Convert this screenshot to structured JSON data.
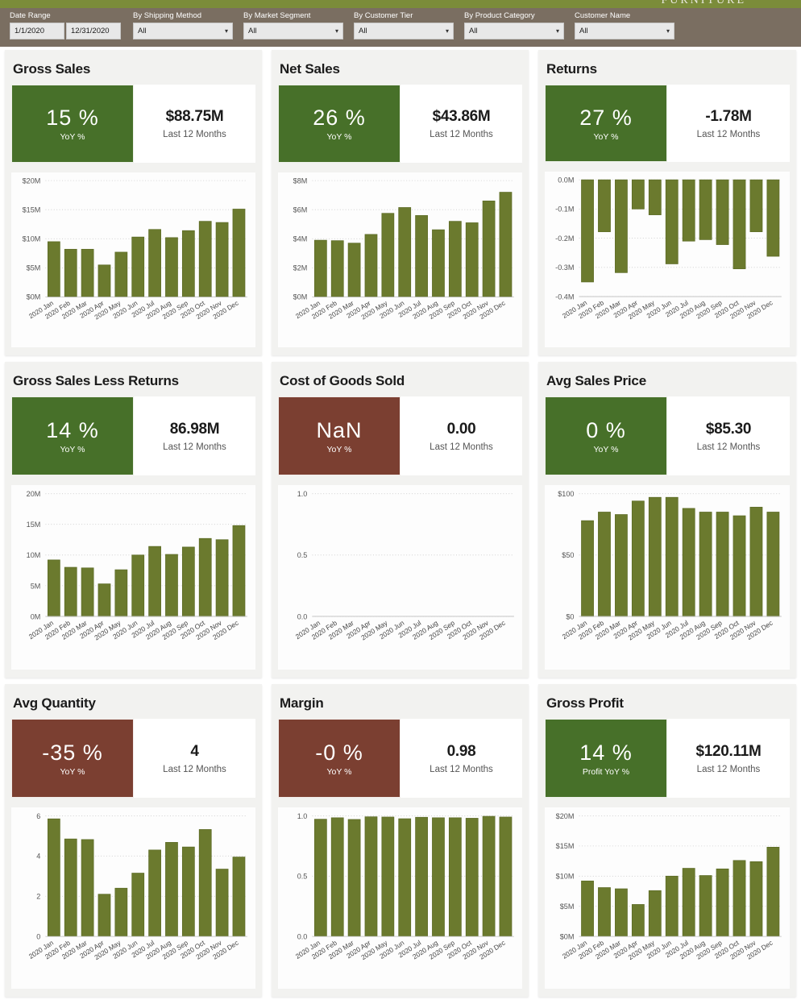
{
  "header": {
    "logo_text": "FURNITURE",
    "filters": [
      {
        "label": "Date Range",
        "type": "daterange",
        "start": "1/1/2020",
        "end": "12/31/2020"
      },
      {
        "label": "By Shipping Method",
        "type": "select",
        "value": "All"
      },
      {
        "label": "By Market Segment",
        "type": "select",
        "value": "All"
      },
      {
        "label": "By Customer Tier",
        "type": "select",
        "value": "All"
      },
      {
        "label": "By Product Category",
        "type": "select",
        "value": "All"
      },
      {
        "label": "Customer Name",
        "type": "select",
        "value": "All"
      }
    ],
    "caret_icon": "⌄"
  },
  "colors": {
    "positive": "#477029",
    "negative": "#7b3f31",
    "bar": "#6b7a2e",
    "filter_bar": "#7a6e61",
    "logo_band": "#7b8c3a"
  },
  "cards": [
    {
      "title": "Gross Sales",
      "kpi_value": "15 %",
      "kpi_label": "YoY %",
      "kpi_state": "pos",
      "value": "$88.75M",
      "value_label": "Last 12 Months"
    },
    {
      "title": "Net Sales",
      "kpi_value": "26 %",
      "kpi_label": "YoY %",
      "kpi_state": "pos",
      "value": "$43.86M",
      "value_label": "Last 12 Months"
    },
    {
      "title": "Returns",
      "kpi_value": "27 %",
      "kpi_label": "YoY %",
      "kpi_state": "pos",
      "value": "-1.78M",
      "value_label": "Last 12 Months"
    },
    {
      "title": "Gross Sales Less Returns",
      "kpi_value": "14 %",
      "kpi_label": "YoY %",
      "kpi_state": "pos",
      "value": "86.98M",
      "value_label": "Last 12 Months"
    },
    {
      "title": "Cost of Goods Sold",
      "kpi_value": "NaN",
      "kpi_label": "YoY %",
      "kpi_state": "neg",
      "value": "0.00",
      "value_label": "Last 12 Months"
    },
    {
      "title": "Avg Sales Price",
      "kpi_value": "0 %",
      "kpi_label": "YoY %",
      "kpi_state": "pos",
      "value": "$85.30",
      "value_label": "Last 12 Months"
    },
    {
      "title": "Avg Quantity",
      "kpi_value": "-35 %",
      "kpi_label": "YoY %",
      "kpi_state": "neg",
      "value": "4",
      "value_label": "Last 12 Months"
    },
    {
      "title": "Margin",
      "kpi_value": "-0 %",
      "kpi_label": "YoY %",
      "kpi_state": "neg",
      "value": "0.98",
      "value_label": "Last 12 Months"
    },
    {
      "title": "Gross Profit",
      "kpi_value": "14 %",
      "kpi_label": "Profit YoY %",
      "kpi_state": "pos",
      "value": "$120.11M",
      "value_label": "Last 12 Months"
    }
  ],
  "chart_data": [
    {
      "type": "bar",
      "title": "Gross Sales",
      "xlabel": "",
      "ylabel": "",
      "categories": [
        "2020 Jan",
        "2020 Feb",
        "2020 Mar",
        "2020 Apr",
        "2020 May",
        "2020 Jun",
        "2020 Jul",
        "2020 Aug",
        "2020 Sep",
        "2020 Oct",
        "2020 Nov",
        "2020 Dec"
      ],
      "values": [
        9.5,
        8.2,
        8.2,
        5.5,
        7.7,
        10.3,
        11.6,
        10.2,
        11.4,
        13.0,
        12.8,
        15.1
      ],
      "ylim": [
        0,
        20
      ],
      "yticks": [
        0,
        5,
        10,
        15,
        20
      ],
      "ytick_labels": [
        "$0M",
        "$5M",
        "$10M",
        "$15M",
        "$20M"
      ],
      "grid": true
    },
    {
      "type": "bar",
      "title": "Net Sales",
      "xlabel": "",
      "ylabel": "",
      "categories": [
        "2020 Jan",
        "2020 Feb",
        "2020 Mar",
        "2020 Apr",
        "2020 May",
        "2020 Jun",
        "2020 Jul",
        "2020 Aug",
        "2020 Sep",
        "2020 Oct",
        "2020 Nov",
        "2020 Dec"
      ],
      "values": [
        3.9,
        3.87,
        3.7,
        4.3,
        5.75,
        6.15,
        5.6,
        4.62,
        5.2,
        5.1,
        6.6,
        7.2
      ],
      "ylim": [
        0,
        8
      ],
      "yticks": [
        0,
        2,
        4,
        6,
        8
      ],
      "ytick_labels": [
        "$0M",
        "$2M",
        "$4M",
        "$6M",
        "$8M"
      ],
      "grid": true
    },
    {
      "type": "bar",
      "title": "Returns",
      "xlabel": "",
      "ylabel": "",
      "categories": [
        "2020 Jan",
        "2020 Feb",
        "2020 Mar",
        "2020 Apr",
        "2020 May",
        "2020 Jun",
        "2020 Jul",
        "2020 Aug",
        "2020 Sep",
        "2020 Oct",
        "2020 Nov",
        "2020 Dec"
      ],
      "values": [
        -0.35,
        -0.178,
        -0.318,
        -0.1,
        -0.12,
        -0.288,
        -0.21,
        -0.205,
        -0.222,
        -0.305,
        -0.178,
        -0.262
      ],
      "ylim": [
        -0.4,
        0.0
      ],
      "yticks": [
        -0.4,
        -0.3,
        -0.2,
        -0.1,
        0.0
      ],
      "ytick_labels": [
        "-0.4M",
        "-0.3M",
        "-0.2M",
        "-0.1M",
        "0.0M"
      ],
      "grid": true
    },
    {
      "type": "bar",
      "title": "Gross Sales Less Returns",
      "xlabel": "",
      "ylabel": "",
      "categories": [
        "2020 Jan",
        "2020 Feb",
        "2020 Mar",
        "2020 Apr",
        "2020 May",
        "2020 Jun",
        "2020 Jul",
        "2020 Aug",
        "2020 Sep",
        "2020 Oct",
        "2020 Nov",
        "2020 Dec"
      ],
      "values": [
        9.2,
        8.0,
        7.9,
        5.3,
        7.6,
        10.0,
        11.4,
        10.1,
        11.3,
        12.7,
        12.5,
        14.8
      ],
      "ylim": [
        0,
        20
      ],
      "yticks": [
        0,
        5,
        10,
        15,
        20
      ],
      "ytick_labels": [
        "0M",
        "5M",
        "10M",
        "15M",
        "20M"
      ],
      "grid": true
    },
    {
      "type": "bar",
      "title": "Cost of Goods Sold",
      "xlabel": "",
      "ylabel": "",
      "categories": [
        "2020 Jan",
        "2020 Feb",
        "2020 Mar",
        "2020 Apr",
        "2020 May",
        "2020 Jun",
        "2020 Jul",
        "2020 Aug",
        "2020 Sep",
        "2020 Oct",
        "2020 Nov",
        "2020 Dec"
      ],
      "values": [
        0,
        0,
        0,
        0,
        0,
        0,
        0,
        0,
        0,
        0,
        0,
        0
      ],
      "ylim": [
        0,
        1
      ],
      "yticks": [
        0,
        0.5,
        1
      ],
      "ytick_labels": [
        "0.0",
        "0.5",
        "1.0"
      ],
      "grid": true
    },
    {
      "type": "bar",
      "title": "Avg Sales Price",
      "xlabel": "",
      "ylabel": "",
      "categories": [
        "2020 Jan",
        "2020 Feb",
        "2020 Mar",
        "2020 Apr",
        "2020 May",
        "2020 Jun",
        "2020 Jul",
        "2020 Aug",
        "2020 Sep",
        "2020 Oct",
        "2020 Nov",
        "2020 Dec"
      ],
      "values": [
        78,
        85,
        83,
        94,
        97,
        97,
        88,
        85,
        85,
        82,
        89,
        85
      ],
      "ylim": [
        0,
        100
      ],
      "yticks": [
        0,
        50,
        100
      ],
      "ytick_labels": [
        "$0",
        "$50",
        "$100"
      ],
      "grid": true
    },
    {
      "type": "bar",
      "title": "Avg Quantity",
      "xlabel": "",
      "ylabel": "",
      "categories": [
        "2020 Jan",
        "2020 Feb",
        "2020 Mar",
        "2020 Apr",
        "2020 May",
        "2020 Jun",
        "2020 Jul",
        "2020 Aug",
        "2020 Sep",
        "2020 Oct",
        "2020 Nov",
        "2020 Dec"
      ],
      "values": [
        5.85,
        4.85,
        4.82,
        2.1,
        2.4,
        3.15,
        4.3,
        4.68,
        4.45,
        5.32,
        3.35,
        3.95
      ],
      "ylim": [
        0,
        6
      ],
      "yticks": [
        0,
        2,
        4,
        6
      ],
      "ytick_labels": [
        "0",
        "2",
        "4",
        "6"
      ],
      "grid": true
    },
    {
      "type": "bar",
      "title": "Margin",
      "xlabel": "",
      "ylabel": "",
      "categories": [
        "2020 Jan",
        "2020 Feb",
        "2020 Mar",
        "2020 Apr",
        "2020 May",
        "2020 Jun",
        "2020 Jul",
        "2020 Aug",
        "2020 Sep",
        "2020 Oct",
        "2020 Nov",
        "2020 Dec"
      ],
      "values": [
        0.972,
        0.984,
        0.97,
        0.992,
        0.99,
        0.976,
        0.988,
        0.984,
        0.984,
        0.98,
        0.996,
        0.99
      ],
      "ylim": [
        0,
        1
      ],
      "yticks": [
        0,
        0.5,
        1
      ],
      "ytick_labels": [
        "0.0",
        "0.5",
        "1.0"
      ],
      "grid": true
    },
    {
      "type": "bar",
      "title": "Gross Profit",
      "xlabel": "",
      "ylabel": "",
      "categories": [
        "2020 Jan",
        "2020 Feb",
        "2020 Mar",
        "2020 Apr",
        "2020 May",
        "2020 Jun",
        "2020 Jul",
        "2020 Aug",
        "2020 Sep",
        "2020 Oct",
        "2020 Nov",
        "2020 Dec"
      ],
      "values": [
        9.2,
        8.1,
        7.9,
        5.3,
        7.6,
        10.0,
        11.3,
        10.1,
        11.2,
        12.6,
        12.4,
        14.8
      ],
      "ylim": [
        0,
        20
      ],
      "yticks": [
        0,
        5,
        10,
        15,
        20
      ],
      "ytick_labels": [
        "$0M",
        "$5M",
        "$10M",
        "$15M",
        "$20M"
      ],
      "grid": true
    }
  ]
}
